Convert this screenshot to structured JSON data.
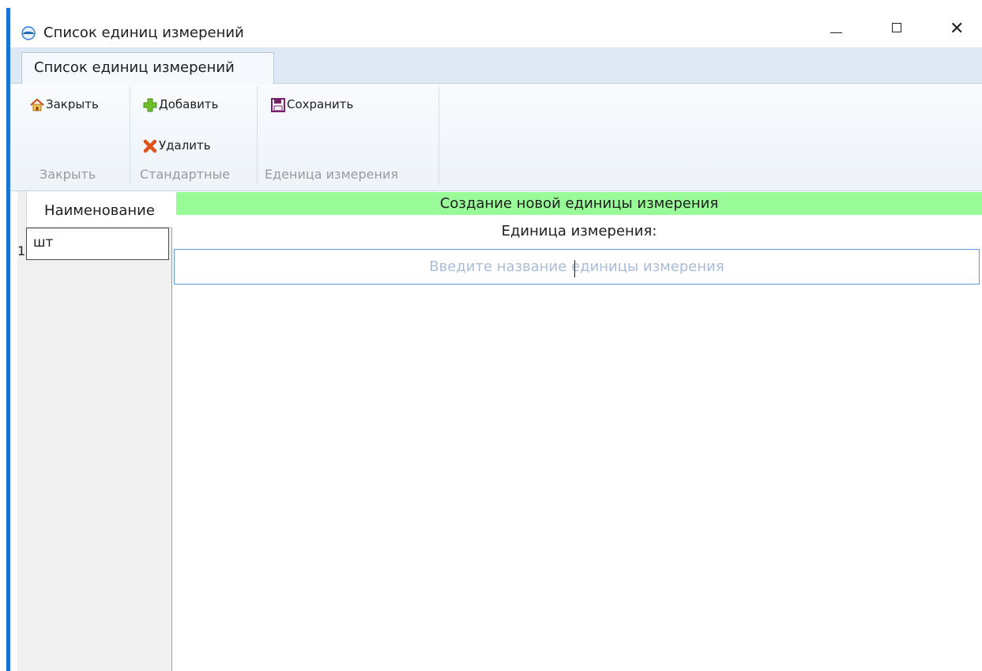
{
  "window": {
    "title": "Список единиц измерений",
    "app_icon": "freshway-logo-icon",
    "controls": {
      "minimize": "minimize-icon",
      "maximize": "maximize-icon",
      "close": "close-icon",
      "close_glyph": "✕"
    },
    "accent_color": "#1a74d6"
  },
  "ribbon": {
    "tab_label": "Список единиц измерений",
    "groups": [
      {
        "label": "Закрыть",
        "buttons": [
          {
            "label": "Закрыть",
            "icon": "home-icon"
          }
        ]
      },
      {
        "label": "Стандартные",
        "buttons": [
          {
            "label": "Добавить",
            "icon": "green-plus-icon"
          },
          {
            "label": "Удалить",
            "icon": "red-x-icon"
          }
        ]
      },
      {
        "label": "Еденица измерения",
        "buttons": [
          {
            "label": "Сохранить",
            "icon": "floppy-disk-icon"
          }
        ]
      }
    ]
  },
  "grid": {
    "column_header": "Наименование",
    "rows": [
      {
        "number": "1",
        "name": "шт"
      }
    ]
  },
  "editor": {
    "header": "Создание новой единицы измерения",
    "header_color": "#98fb98",
    "field_label": "Единица измерения:",
    "input_placeholder": "Введите название единицы измерения",
    "input_value": ""
  }
}
